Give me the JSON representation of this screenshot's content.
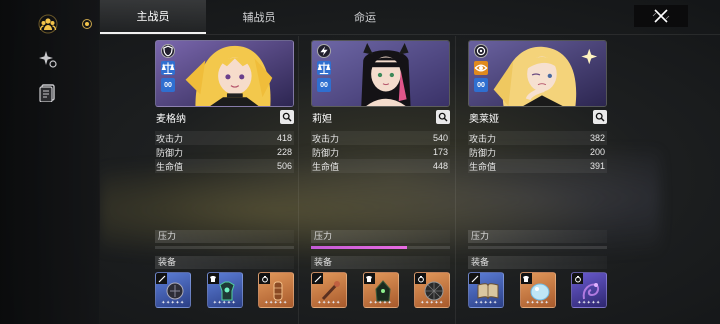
{
  "tabs": [
    {
      "label": "主战员",
      "active": true
    },
    {
      "label": "辅战员",
      "active": false
    },
    {
      "label": "命运",
      "active": false
    }
  ],
  "sidebar": {
    "icons": [
      "squad-icon",
      "sparkle-icon",
      "card-icon"
    ]
  },
  "labels": {
    "atk": "攻击力",
    "def": "防御力",
    "hp": "生命值",
    "pressure": "压力",
    "equipment": "装备"
  },
  "characters": [
    {
      "name": "麦格纳",
      "rank": "00",
      "attack": "418",
      "defense": "228",
      "hp": "506",
      "pressure_fraction": 0.0,
      "type_icon": "shield-icon",
      "class_icon": "scales-icon",
      "equipment": [
        {
          "slot": "weapon-icon",
          "rarity": "blue",
          "stars": "✦✦✦✦✦"
        },
        {
          "slot": "armor-icon",
          "rarity": "blue",
          "stars": "✦✦✦✦✦"
        },
        {
          "slot": "ring-icon",
          "rarity": "orange",
          "stars": "✦✦✦✦✦"
        }
      ]
    },
    {
      "name": "莉妲",
      "rank": "00",
      "attack": "540",
      "defense": "173",
      "hp": "448",
      "pressure_fraction": 0.69,
      "type_icon": "lightning-icon",
      "class_icon": "scales-icon",
      "equipment": [
        {
          "slot": "weapon-icon",
          "rarity": "orange",
          "stars": "✦✦✦✦✦"
        },
        {
          "slot": "armor-icon",
          "rarity": "orange",
          "stars": "✦✦✦✦✦"
        },
        {
          "slot": "ring-icon",
          "rarity": "orange",
          "stars": "✦✦✦✦✦"
        }
      ]
    },
    {
      "name": "奥莱娅",
      "rank": "00",
      "attack": "382",
      "defense": "200",
      "hp": "391",
      "pressure_fraction": 0.0,
      "type_icon": "circle-icon",
      "class_icon": "eye-icon",
      "equipment": [
        {
          "slot": "weapon-icon",
          "rarity": "blue",
          "stars": "✦✦✦✦✦"
        },
        {
          "slot": "armor-icon",
          "rarity": "orange",
          "stars": "✦✦✦✦✦"
        },
        {
          "slot": "ring-icon",
          "rarity": "purple",
          "stars": "✦✦✦✦✦"
        }
      ]
    }
  ]
}
